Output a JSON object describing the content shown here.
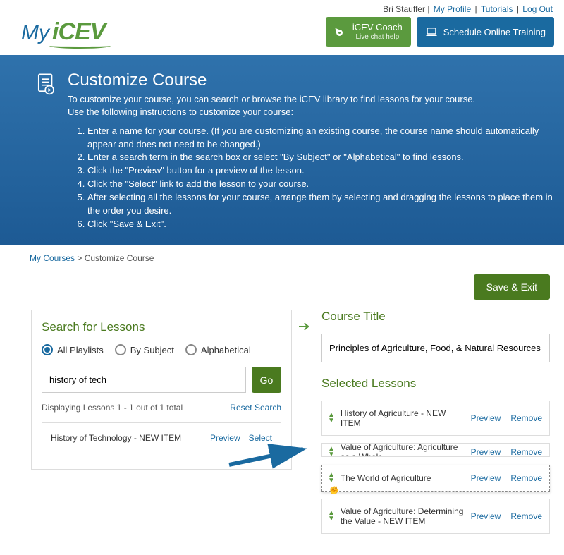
{
  "user": {
    "name": "Bri Stauffer"
  },
  "topLinks": {
    "profile": "My Profile",
    "tutorials": "Tutorials",
    "logout": "Log Out"
  },
  "logo": {
    "my": "My",
    "icev": "iCEV"
  },
  "headerButtons": {
    "coach": {
      "title": "iCEV Coach",
      "sub": "Live chat help"
    },
    "training": "Schedule Online Training"
  },
  "hero": {
    "title": "Customize Course",
    "intro1": "To customize your course, you can search or browse the iCEV library to find lessons for your course.",
    "intro2": "Use the following instructions to customize your course:",
    "steps": [
      "Enter a name for your course. (If you are customizing an existing course, the course name should automatically appear and does not need to be changed.)",
      "Enter a search term in the search box or select \"By Subject\" or \"Alphabetical\" to find lessons.",
      "Click the \"Preview\" button for a preview of the lesson.",
      "Click the \"Select\" link to add the lesson to your course.",
      "After selecting all the lessons for your course, arrange them by selecting and dragging the lessons to place them in the order you desire.",
      "Click \"Save & Exit\"."
    ]
  },
  "breadcrumb": {
    "root": "My Courses",
    "sep": ">",
    "current": "Customize Course"
  },
  "saveExit": "Save & Exit",
  "searchPanel": {
    "heading": "Search for Lessons",
    "radios": {
      "all": "All Playlists",
      "bySubject": "By Subject",
      "alpha": "Alphabetical"
    },
    "query": "history of tech",
    "go": "Go",
    "count": "Displaying Lessons 1 - 1 out of 1 total",
    "reset": "Reset Search",
    "result": {
      "name": "History of Technology - NEW ITEM",
      "preview": "Preview",
      "select": "Select"
    }
  },
  "coursePanel": {
    "titleHeading": "Course Title",
    "titleValue": "Principles of Agriculture, Food, & Natural Resources",
    "selectedHeading": "Selected Lessons",
    "previewLabel": "Preview",
    "removeLabel": "Remove",
    "lessons": [
      {
        "name": "History of Agriculture - NEW ITEM"
      },
      {
        "name": "Value of Agriculture: Agriculture as a Whole"
      },
      {
        "name": "The World of Agriculture"
      },
      {
        "name": "Value of Agriculture: Determining the Value - NEW ITEM"
      }
    ]
  }
}
